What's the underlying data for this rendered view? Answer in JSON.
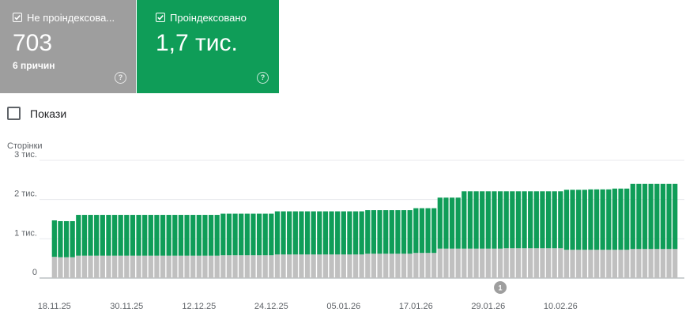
{
  "cards": [
    {
      "label": "Не проіндексова...",
      "value": "703",
      "sub": "6 причин",
      "color": "#9e9e9e"
    },
    {
      "label": "Проіндексовано",
      "value": "1,7 тис.",
      "sub": "",
      "color": "#0f9d58"
    }
  ],
  "help_glyph": "?",
  "show_toggle": {
    "label": "Покази",
    "checked": false
  },
  "chart_data": {
    "type": "bar",
    "stacked": true,
    "ylabel": "Сторінки",
    "ylim": [
      0,
      3000
    ],
    "yticks": [
      {
        "value": 0,
        "label": "0"
      },
      {
        "value": 1000,
        "label": "1 тис."
      },
      {
        "value": 2000,
        "label": "2 тис."
      },
      {
        "value": 3000,
        "label": "3 тис."
      }
    ],
    "grid": true,
    "x_labels": [
      {
        "index": 0,
        "label": "18.11.25"
      },
      {
        "index": 12,
        "label": "30.11.25"
      },
      {
        "index": 24,
        "label": "12.12.25"
      },
      {
        "index": 36,
        "label": "24.12.25"
      },
      {
        "index": 48,
        "label": "05.01.26"
      },
      {
        "index": 60,
        "label": "17.01.26"
      },
      {
        "index": 72,
        "label": "29.01.26"
      },
      {
        "index": 84,
        "label": "10.02.26"
      }
    ],
    "annotations": [
      {
        "index": 74,
        "label": "1"
      }
    ],
    "series": [
      {
        "name": "Не проіндексовано",
        "color": "#c0c0c0",
        "values": [
          540,
          530,
          530,
          530,
          570,
          570,
          570,
          570,
          570,
          570,
          570,
          570,
          570,
          570,
          570,
          570,
          570,
          570,
          570,
          570,
          570,
          570,
          570,
          570,
          570,
          570,
          570,
          570,
          580,
          580,
          580,
          580,
          580,
          580,
          580,
          580,
          580,
          600,
          600,
          600,
          600,
          600,
          600,
          600,
          600,
          600,
          600,
          600,
          600,
          600,
          600,
          600,
          620,
          620,
          620,
          620,
          620,
          620,
          620,
          620,
          640,
          640,
          640,
          640,
          750,
          750,
          750,
          750,
          750,
          750,
          750,
          750,
          750,
          750,
          750,
          760,
          760,
          760,
          760,
          760,
          760,
          760,
          760,
          760,
          760,
          720,
          720,
          720,
          720,
          720,
          720,
          720,
          720,
          720,
          720,
          720,
          740,
          740,
          740,
          740,
          740,
          740,
          740,
          740
        ]
      },
      {
        "name": "Проіндексовано",
        "color": "#0f9d58",
        "values": [
          930,
          920,
          920,
          920,
          1040,
          1040,
          1040,
          1040,
          1040,
          1040,
          1040,
          1040,
          1040,
          1040,
          1040,
          1040,
          1040,
          1040,
          1040,
          1040,
          1040,
          1040,
          1040,
          1040,
          1040,
          1040,
          1040,
          1040,
          1060,
          1060,
          1060,
          1060,
          1060,
          1060,
          1060,
          1060,
          1060,
          1100,
          1100,
          1100,
          1100,
          1100,
          1100,
          1100,
          1100,
          1100,
          1100,
          1100,
          1100,
          1100,
          1100,
          1100,
          1110,
          1110,
          1110,
          1110,
          1110,
          1110,
          1110,
          1110,
          1140,
          1140,
          1140,
          1140,
          1300,
          1300,
          1300,
          1300,
          1460,
          1460,
          1460,
          1460,
          1460,
          1460,
          1460,
          1450,
          1450,
          1450,
          1450,
          1450,
          1450,
          1450,
          1450,
          1450,
          1450,
          1530,
          1530,
          1530,
          1530,
          1540,
          1540,
          1540,
          1540,
          1560,
          1560,
          1560,
          1660,
          1660,
          1660,
          1660,
          1660,
          1660,
          1660,
          1660
        ]
      }
    ]
  }
}
